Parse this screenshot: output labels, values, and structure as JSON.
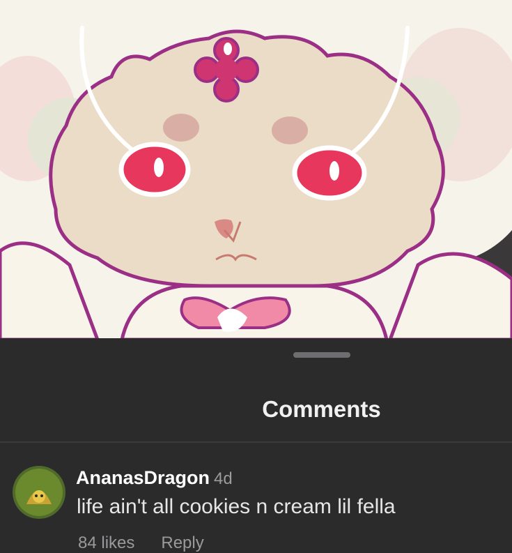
{
  "sheet": {
    "title": "Comments"
  },
  "comment": {
    "username": "AnanasDragon",
    "age": "4d",
    "text": "life ain't all cookies n cream lil fella",
    "likes": "84 likes",
    "reply": "Reply"
  },
  "colors": {
    "sheet_bg": "#2b2b2c",
    "title": "#f1f1f1",
    "meta": "#9c9c9e",
    "art_outline": "#9b2f86",
    "art_eye": "#e8375c"
  }
}
